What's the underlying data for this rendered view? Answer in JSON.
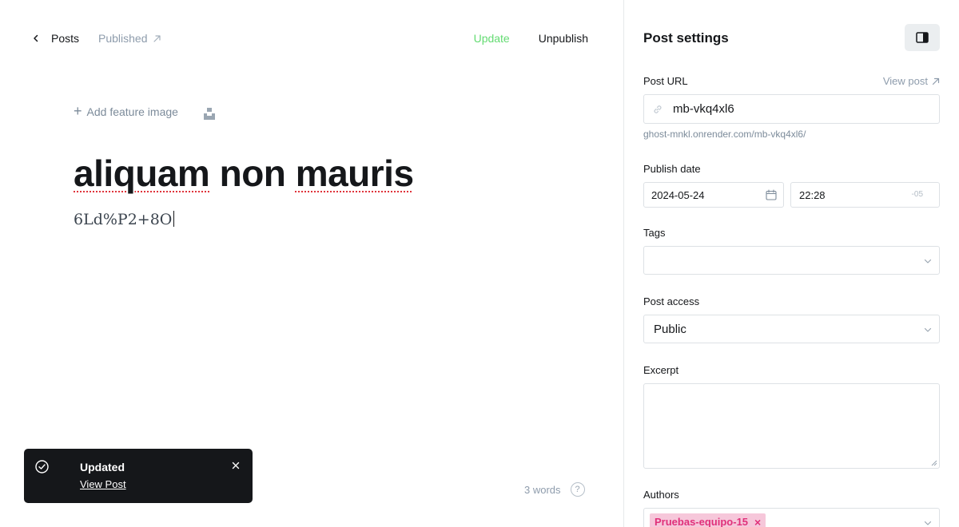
{
  "header": {
    "back_label": "Posts",
    "status_label": "Published",
    "update_label": "Update",
    "unpublish_label": "Unpublish"
  },
  "editor": {
    "feature_image_label": "Add feature image",
    "title_words": [
      "aliquam",
      "non",
      "mauris"
    ],
    "body_text": "6Ld%P2+8O",
    "word_count": "3 words",
    "help_glyph": "?"
  },
  "toast": {
    "title": "Updated",
    "link_label": "View Post"
  },
  "settings": {
    "title": "Post settings",
    "post_url_label": "Post URL",
    "view_post_label": "View post",
    "slug": "mb-vkq4xl6",
    "url_hint": "ghost-mnkl.onrender.com/mb-vkq4xl6/",
    "publish_date_label": "Publish date",
    "date": "2024-05-24",
    "time": "22:28",
    "timezone": "-05",
    "tags_label": "Tags",
    "tags_value": "",
    "post_access_label": "Post access",
    "post_access_value": "Public",
    "excerpt_label": "Excerpt",
    "excerpt_value": "",
    "authors_label": "Authors",
    "author_chip": "Pruebas-equipo-15",
    "chip_remove": "×"
  },
  "colors": {
    "accent_green": "#30cf43",
    "toast_bg": "#15171a",
    "author_chip_bg": "#f6c7da",
    "author_chip_text": "#e0307a",
    "spellcheck_underline": "#e0343b"
  },
  "icons": [
    "chevron-left-icon",
    "external-arrow-icon",
    "unsplash-icon",
    "check-circle-icon",
    "close-icon",
    "sidebar-toggle-icon",
    "link-icon",
    "calendar-icon",
    "chevron-down-icon"
  ]
}
